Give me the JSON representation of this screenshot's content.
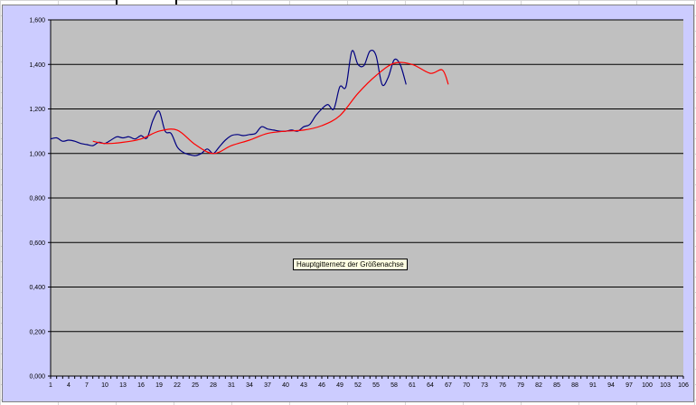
{
  "chart_data": {
    "type": "line",
    "title": "",
    "xlabel": "",
    "ylabel": "",
    "ylim": [
      0,
      1.6
    ],
    "xlim": [
      1,
      106
    ],
    "grid": true,
    "y_ticks": [
      "0,000",
      "0,200",
      "0,400",
      "0,600",
      "0,800",
      "1,000",
      "1,200",
      "1,400",
      "1,600"
    ],
    "x_ticks": [
      "1",
      "4",
      "7",
      "10",
      "13",
      "16",
      "19",
      "22",
      "25",
      "28",
      "31",
      "34",
      "37",
      "40",
      "43",
      "46",
      "49",
      "52",
      "55",
      "58",
      "61",
      "64",
      "67",
      "70",
      "73",
      "76",
      "79",
      "82",
      "85",
      "88",
      "91",
      "94",
      "97",
      "100",
      "103",
      "106"
    ],
    "colors": {
      "plot_bg": "#c0c0c0",
      "frame_bg": "#ccccff",
      "grid": "#000000"
    },
    "series": [
      {
        "color": "#000080",
        "x": [
          1,
          2,
          3,
          4,
          5,
          6,
          7,
          8,
          9,
          10,
          11,
          12,
          13,
          14,
          15,
          16,
          17,
          18,
          19,
          20,
          21,
          22,
          23,
          24,
          25,
          26,
          27,
          28,
          29,
          30,
          31,
          32,
          33,
          34,
          35,
          36,
          37,
          38,
          39,
          40,
          41,
          42,
          43,
          44,
          45,
          46,
          47,
          48,
          49,
          50,
          51,
          52,
          53,
          54,
          55,
          56,
          57,
          58,
          59,
          60,
          61
        ],
        "y": [
          1.065,
          1.07,
          1.055,
          1.06,
          1.055,
          1.045,
          1.04,
          1.035,
          1.05,
          1.045,
          1.06,
          1.075,
          1.07,
          1.075,
          1.065,
          1.08,
          1.07,
          1.15,
          1.19,
          1.1,
          1.09,
          1.03,
          1.005,
          0.995,
          0.99,
          1.0,
          1.02,
          1.0,
          1.03,
          1.06,
          1.08,
          1.085,
          1.08,
          1.085,
          1.09,
          1.12,
          1.11,
          1.105,
          1.1,
          1.1,
          1.105,
          1.1,
          1.12,
          1.13,
          1.17,
          1.2,
          1.22,
          1.2,
          1.3,
          1.3,
          1.46,
          1.4,
          1.395,
          1.46,
          1.44,
          1.31,
          1.34,
          1.42,
          1.4,
          1.31,
          null
        ]
      },
      {
        "color": "#ff0000",
        "x": [
          8,
          10,
          13,
          16,
          19,
          22,
          25,
          28,
          31,
          34,
          37,
          40,
          43,
          46,
          49,
          52,
          55,
          58,
          61,
          64,
          66,
          67
        ],
        "y": [
          1.055,
          1.045,
          1.05,
          1.065,
          1.1,
          1.105,
          1.04,
          1.0,
          1.035,
          1.06,
          1.09,
          1.1,
          1.105,
          1.125,
          1.17,
          1.27,
          1.35,
          1.405,
          1.4,
          1.36,
          1.375,
          1.31
        ]
      }
    ],
    "annotation": "Hauptgitternetz der Größenachse"
  }
}
